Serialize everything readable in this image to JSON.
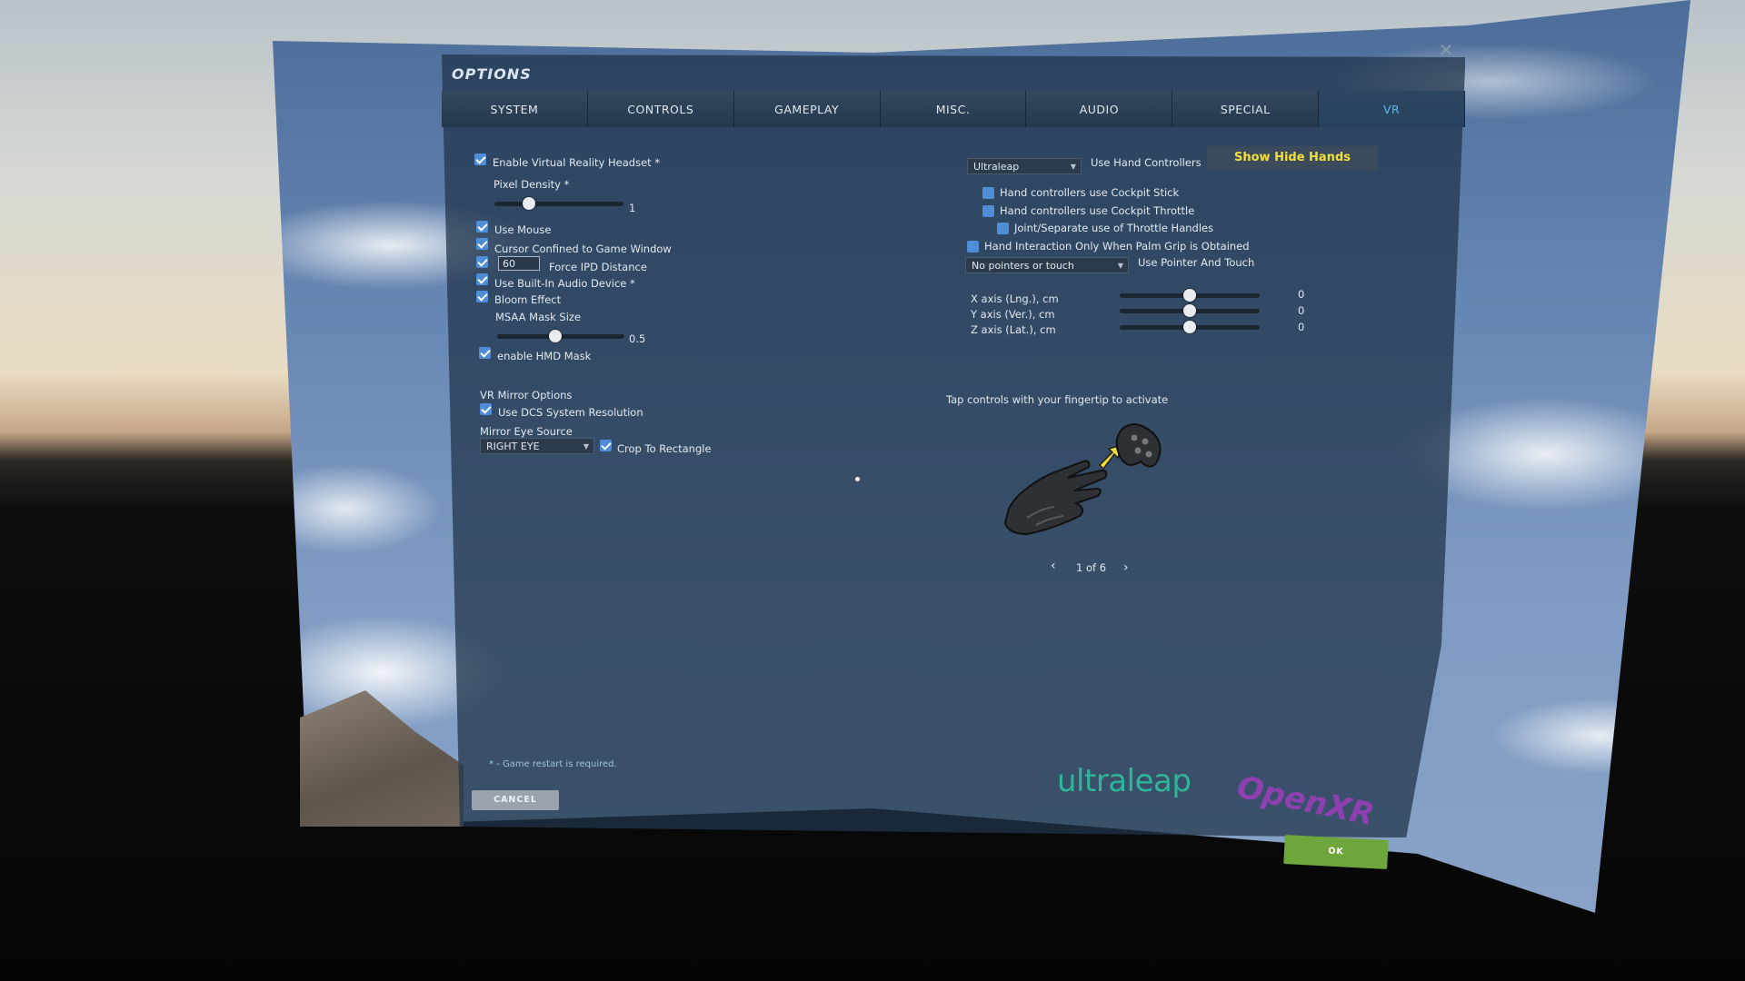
{
  "dialog": {
    "title": "OPTIONS",
    "close": "✕"
  },
  "tabs": [
    "SYSTEM",
    "CONTROLS",
    "GAMEPLAY",
    "MISC.",
    "AUDIO",
    "SPECIAL",
    "VR"
  ],
  "active_tab": "VR",
  "left": {
    "enable_vr": {
      "label": "Enable Virtual Reality Headset *",
      "checked": true
    },
    "pixel_density": {
      "label": "Pixel Density *",
      "value": "1",
      "level": 0.27
    },
    "use_mouse": {
      "label": "Use Mouse",
      "checked": true
    },
    "cursor_confined": {
      "label": "Cursor Confined to Game Window",
      "checked": true
    },
    "force_ipd": {
      "label": "Force IPD Distance",
      "value": "60",
      "checked": true
    },
    "builtin_audio": {
      "label": "Use Built-In Audio Device *",
      "checked": true
    },
    "bloom": {
      "label": "Bloom Effect",
      "checked": true
    },
    "msaa": {
      "label": "MSAA Mask Size",
      "value": "0.5",
      "level": 0.46
    },
    "hmd_mask": {
      "label": "enable HMD Mask",
      "checked": true
    },
    "mirror_heading": "VR Mirror Options",
    "dcs_resolution": {
      "label": "Use DCS System Resolution",
      "checked": true
    },
    "mirror_eye_label": "Mirror Eye Source",
    "mirror_eye_value": "RIGHT EYE",
    "crop_rect": {
      "label": "Crop To Rectangle",
      "checked": true
    }
  },
  "right": {
    "hand_tracker": "Ultraleap",
    "use_hand_controllers_label": "Use Hand Controllers",
    "show_hide_hands": "Show Hide Hands",
    "cockpit_stick": {
      "label": "Hand controllers use Cockpit Stick",
      "checked": false
    },
    "cockpit_throttle": {
      "label": "Hand controllers use Cockpit Throttle",
      "checked": false
    },
    "throttle_handles": {
      "label": "Joint/Separate use of Throttle Handles",
      "checked": false
    },
    "palm_grip": {
      "label": "Hand Interaction Only When Palm Grip is Obtained",
      "checked": false
    },
    "pointer_mode": "No pointers or touch",
    "pointer_label": "Use Pointer And Touch",
    "x_axis": {
      "label": "X axis (Lng.), cm",
      "value": "0",
      "level": 0.5
    },
    "y_axis": {
      "label": "Y axis (Ver.), cm",
      "value": "0",
      "level": 0.5
    },
    "z_axis": {
      "label": "Z axis (Lat.), cm",
      "value": "0",
      "level": 0.5
    },
    "tap_hint": "Tap controls with your fingertip to activate",
    "pager": "1 of 6"
  },
  "footer": {
    "restart_note": "* - Game restart is required.",
    "cancel": "CANCEL",
    "ok": "OK",
    "logo_ultraleap": "ultraleap",
    "logo_openxr": "OpenXR"
  },
  "colors": {
    "accent": "#5fb8e6",
    "checkbox": "#4f8ed6",
    "ok": "#6ea53c",
    "show_hide": "#f2e03a",
    "ultraleap": "#2eb59a",
    "openxr": "#8e3fb0"
  }
}
